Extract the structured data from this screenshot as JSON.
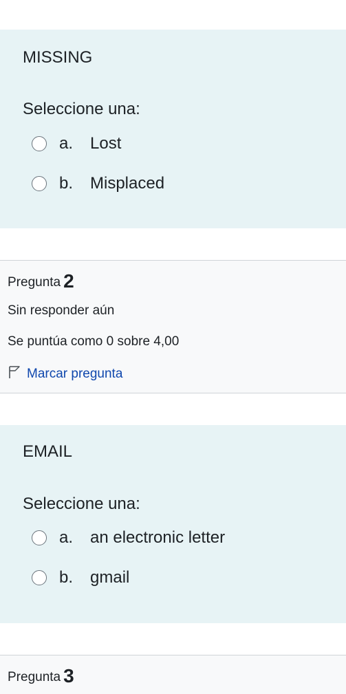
{
  "question1": {
    "qtext": "MISSING",
    "prompt": "Seleccione una:",
    "options": [
      {
        "letter": "a.",
        "text": "Lost"
      },
      {
        "letter": "b.",
        "text": "Misplaced"
      }
    ]
  },
  "question2": {
    "info": {
      "label": "Pregunta",
      "number": "2",
      "state": "Sin responder aún",
      "grade": "Se puntúa como 0 sobre 4,00",
      "flag_label": "Marcar pregunta"
    },
    "qtext": "EMAIL",
    "prompt": "Seleccione una:",
    "options": [
      {
        "letter": "a.",
        "text": "an electronic letter"
      },
      {
        "letter": "b.",
        "text": "gmail"
      }
    ]
  },
  "question3": {
    "info": {
      "label": "Pregunta",
      "number": "3"
    }
  },
  "colors": {
    "question_bg": "#e7f3f5",
    "info_bg": "#f8f9fa",
    "link": "#0f47ad"
  }
}
